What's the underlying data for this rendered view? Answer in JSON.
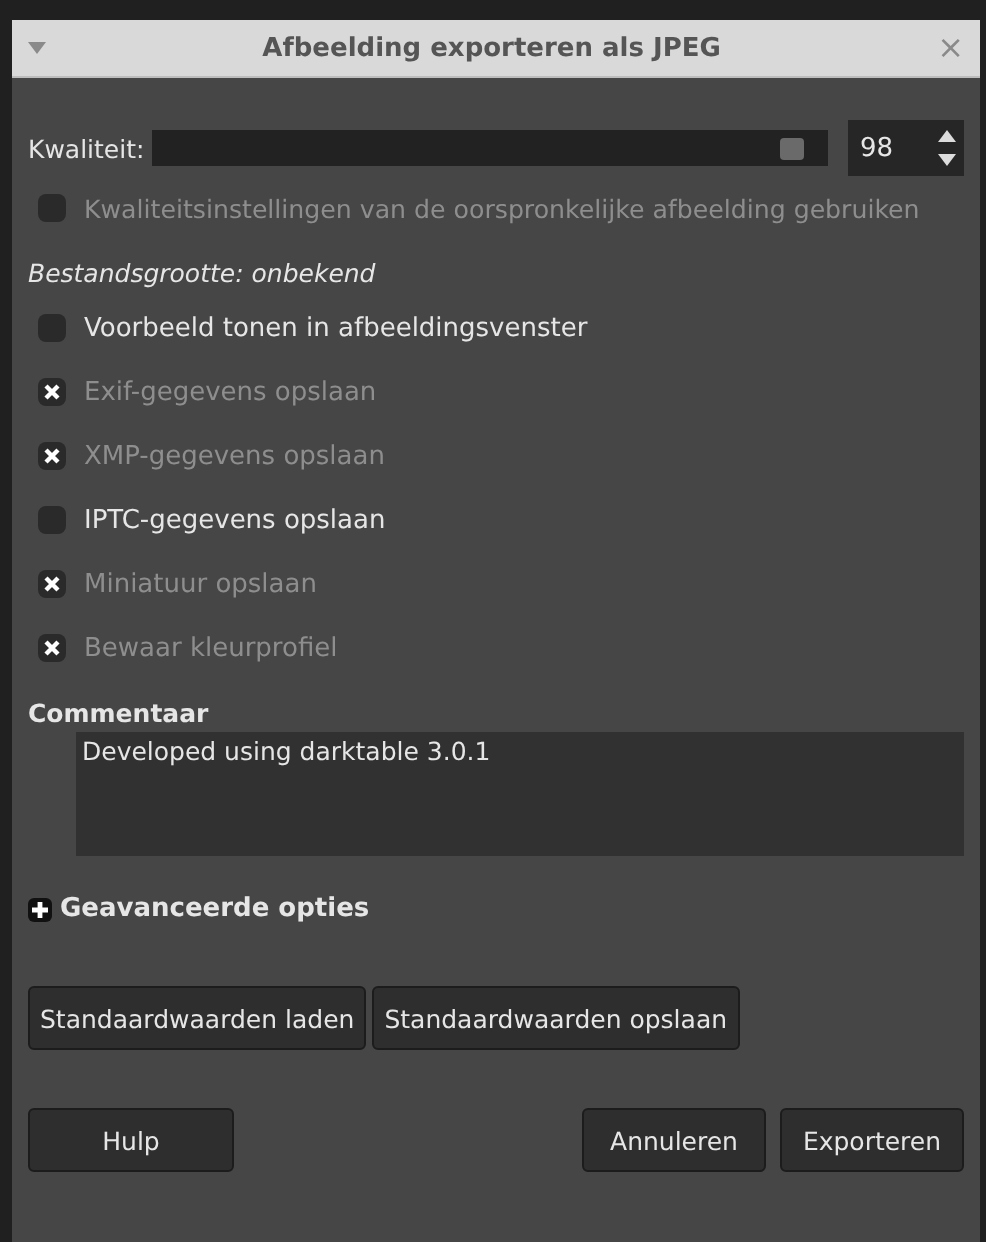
{
  "window": {
    "title": "Afbeelding exporteren als JPEG",
    "close": "×"
  },
  "quality": {
    "label": "Kwaliteit:",
    "level": 0.98,
    "value": "98"
  },
  "options_top": [
    {
      "label": "Kwaliteitsinstellingen van de oorspronkelijke afbeelding gebruiken",
      "checked": false,
      "disabled": true
    }
  ],
  "file_size": "Bestandsgrootte: onbekend",
  "preview": {
    "label": "Voorbeeld tonen in afbeeldingsvenster",
    "checked": false,
    "disabled": false
  },
  "metadata": [
    {
      "label": "Exif-gegevens opslaan",
      "checked": true,
      "disabled": true
    },
    {
      "label": "XMP-gegevens opslaan",
      "checked": true,
      "disabled": true
    },
    {
      "label": "IPTC-gegevens opslaan",
      "checked": false,
      "disabled": false
    },
    {
      "label": "Miniatuur opslaan",
      "checked": true,
      "disabled": true
    },
    {
      "label": "Bewaar kleurprofiel",
      "checked": true,
      "disabled": true
    }
  ],
  "comment": {
    "label": "Commentaar",
    "value": "Developed using darktable 3.0.1"
  },
  "advanced": {
    "label": "Geavanceerde opties",
    "expanded": false
  },
  "defaults_buttons": [
    "Standaardwaarden laden",
    "Standaardwaarden opslaan"
  ],
  "footer": {
    "help": "Hulp",
    "buttons": [
      "Annuleren",
      "Exporteren"
    ]
  }
}
